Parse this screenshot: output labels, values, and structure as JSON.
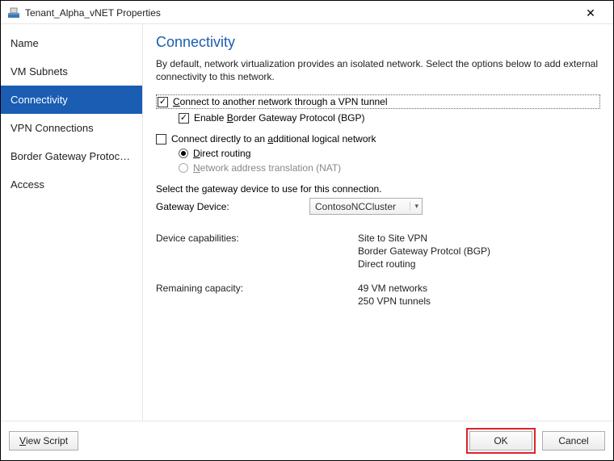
{
  "window": {
    "title": "Tenant_Alpha_vNET Properties"
  },
  "sidebar": {
    "items": [
      {
        "label": "Name"
      },
      {
        "label": "VM Subnets"
      },
      {
        "label": "Connectivity"
      },
      {
        "label": "VPN Connections"
      },
      {
        "label": "Border Gateway Protocol..."
      },
      {
        "label": "Access"
      }
    ]
  },
  "content": {
    "heading": "Connectivity",
    "description": "By default, network virtualization provides an isolated network. Select the options below to add external connectivity to this network.",
    "opt_vpn_prefix": "C",
    "opt_vpn_rest": "onnect to another network through a VPN tunnel",
    "opt_bgp_prefix": "Enable ",
    "opt_bgp_accel": "B",
    "opt_bgp_rest": "order Gateway Protocol (BGP)",
    "opt_direct_prefix": "Connect directly to an ",
    "opt_direct_accel": "a",
    "opt_direct_rest": "dditional logical network",
    "opt_routing_accel": "D",
    "opt_routing_rest": "irect routing",
    "opt_nat_accel": "N",
    "opt_nat_rest": "etwork address translation (NAT)",
    "gateway_intro": "Select the gateway device to use for this connection.",
    "gateway_label_accel": "G",
    "gateway_label_rest": "ateway Device:",
    "gateway_value": "ContosoNCCluster",
    "caps_label": "Device capabilities:",
    "caps": {
      "l1": "Site to Site VPN",
      "l2": "Border Gateway Protcol (BGP)",
      "l3": "Direct routing"
    },
    "remaining_label": "Remaining capacity:",
    "remaining": {
      "l1": "49 VM networks",
      "l2": "250 VPN tunnels"
    }
  },
  "footer": {
    "viewscript_accel": "V",
    "viewscript_rest": "iew Script",
    "ok": "OK",
    "cancel": "Cancel"
  }
}
